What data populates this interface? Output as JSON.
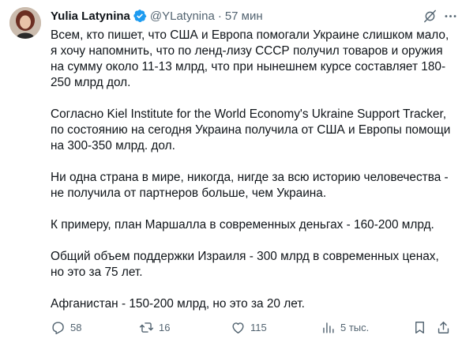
{
  "author": {
    "name": "Yulia Latynina",
    "handle": "@YLatynina",
    "separator": "·",
    "time": "57 мин"
  },
  "post": {
    "paragraphs": [
      "Всем, кто пишет, что США и Европа помогали Украине слишком мало, я хочу напомнить, что по ленд-лизу СССР получил товаров и оружия на сумму около 11-13 млрд, что при нынешнем курсе составляет 180-250 млрд дол.",
      "Согласно Kiel Institute for the World Economy's Ukraine Support Tracker, по состоянию на сегодня Украина получила от США и Европы помощи на 300-350 млрд. дол.",
      "Ни одна страна в мире, никогда, нигде за всю историю человечества - не получила от партнеров больше, чем Украина.",
      "К примеру, план Маршалла в современных деньгах - 160-200 млрд.",
      "Общий объем поддержки Израиля - 300 млрд в современных ценах, но это за 75 лет.",
      "Афганистан - 150-200 млрд, но это за 20 лет."
    ]
  },
  "actions": {
    "replies": "58",
    "reposts": "16",
    "likes": "115",
    "views": "5 тыс."
  },
  "icons": {
    "verified": "verified-badge-icon",
    "grok": "grok-icon",
    "more": "more-icon",
    "reply": "reply-icon",
    "repost": "repost-icon",
    "like": "like-icon",
    "views": "views-icon",
    "bookmark": "bookmark-icon",
    "share": "share-icon"
  },
  "colors": {
    "text": "#0f1419",
    "secondary": "#536471",
    "verified": "#1d9bf0"
  }
}
